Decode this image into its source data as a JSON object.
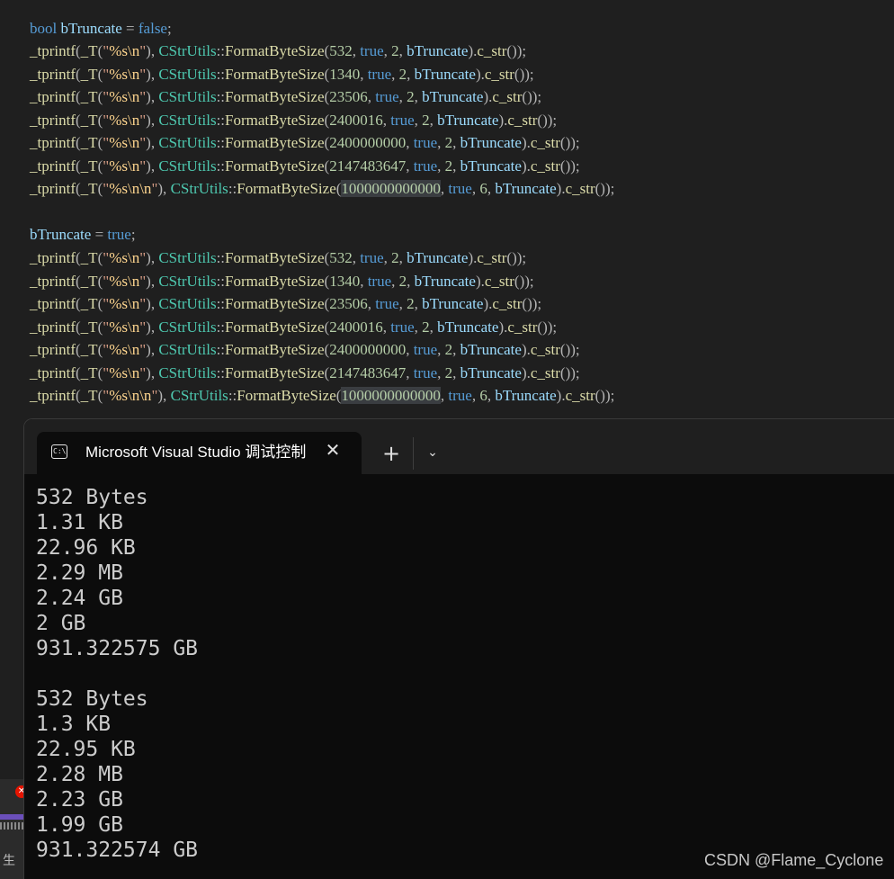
{
  "editor": {
    "decl1": {
      "type": "bool",
      "var": "bTruncate",
      "op": " = ",
      "val": "false",
      "end": ";"
    },
    "decl2": {
      "var": "bTruncate",
      "op": " = ",
      "val": "true",
      "end": ";"
    },
    "calls": [
      {
        "num": "532",
        "dec": "2",
        "nn": false,
        "hl": false
      },
      {
        "num": "1340",
        "dec": "2",
        "nn": false,
        "hl": false
      },
      {
        "num": "23506",
        "dec": "2",
        "nn": false,
        "hl": false
      },
      {
        "num": "2400016",
        "dec": "2",
        "nn": false,
        "hl": false
      },
      {
        "num": "2400000000",
        "dec": "2",
        "nn": false,
        "hl": false
      },
      {
        "num": "2147483647",
        "dec": "2",
        "nn": false,
        "hl": false
      },
      {
        "num": "1000000000000",
        "dec": "6",
        "nn": true,
        "hl": true
      }
    ],
    "tokens": {
      "fn": "_tprintf",
      "macro": "_T",
      "fmt_n": "\"%s\\n\"",
      "fmt_nn": "\"%s\\n\\n\"",
      "cls": "CStrUtils",
      "scope": "::",
      "method": "FormatByteSize",
      "bool_true": "true",
      "var": "bTruncate",
      "cstr": "c_str"
    }
  },
  "terminal": {
    "tab_title": "Microsoft Visual Studio 调试控制台",
    "tab_icon": "C:\\",
    "close_icon": "✕",
    "new_tab_icon": "+",
    "dropdown_icon": "⌄",
    "output": [
      "532 Bytes",
      "1.31 KB",
      "22.96 KB",
      "2.29 MB",
      "2.24 GB",
      "2 GB",
      "931.322575 GB",
      "",
      "532 Bytes",
      "1.3 KB",
      "22.95 KB",
      "2.28 MB",
      "2.23 GB",
      "1.99 GB",
      "931.322574 GB"
    ]
  },
  "ide": {
    "error_icon": "✕",
    "char": "生"
  },
  "watermark": "CSDN @Flame_Cyclone"
}
